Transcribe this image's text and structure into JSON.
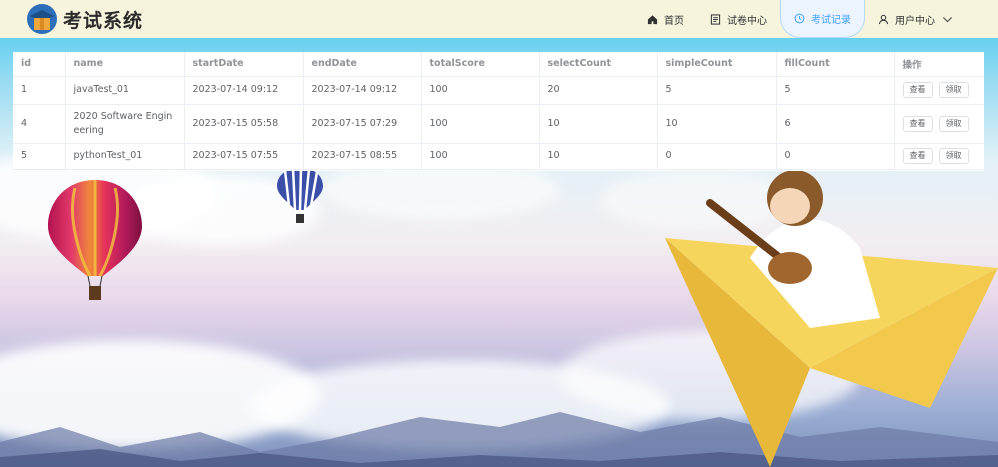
{
  "header": {
    "brand": "考试系统",
    "nav": [
      {
        "label": "首页",
        "icon": "home-icon"
      },
      {
        "label": "试卷中心",
        "icon": "document-icon"
      },
      {
        "label": "考试记录",
        "icon": "clock-icon",
        "active": true
      },
      {
        "label": "用户中心",
        "icon": "user-icon"
      }
    ]
  },
  "table": {
    "columns": [
      "id",
      "name",
      "startDate",
      "endDate",
      "totalScore",
      "selectCount",
      "simpleCount",
      "fillCount",
      "操作"
    ],
    "rows": [
      {
        "id": "1",
        "name": "javaTest_01",
        "startDate": "2023-07-14 09:12",
        "endDate": "2023-07-14 09:12",
        "totalScore": "100",
        "selectCount": "20",
        "simpleCount": "5",
        "fillCount": "5"
      },
      {
        "id": "4",
        "name": "2020 Software Engineering",
        "startDate": "2023-07-15 05:58",
        "endDate": "2023-07-15 07:29",
        "totalScore": "100",
        "selectCount": "10",
        "simpleCount": "10",
        "fillCount": "6"
      },
      {
        "id": "5",
        "name": "pythonTest_01",
        "startDate": "2023-07-15 07:55",
        "endDate": "2023-07-15 08:55",
        "totalScore": "100",
        "selectCount": "10",
        "simpleCount": "0",
        "fillCount": "0"
      }
    ],
    "actions": {
      "view": "查看",
      "claim": "领取"
    }
  },
  "colors": {
    "accent": "#409eff",
    "header_bg": "#f7f4dd"
  }
}
